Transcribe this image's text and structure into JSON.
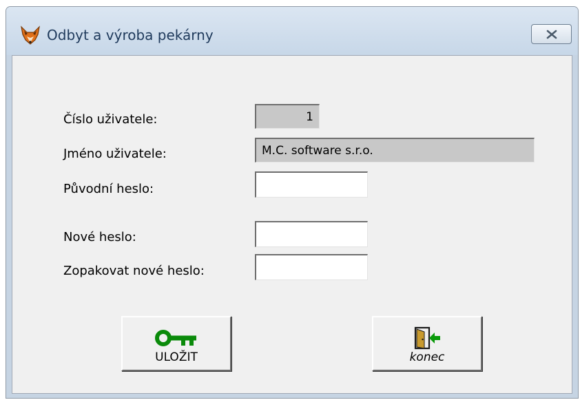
{
  "window": {
    "title": "Odbyt a výroba pekárny",
    "icon": "fox-icon",
    "close_icon": "close-icon"
  },
  "form": {
    "user_number_label": "Číslo uživatele:",
    "user_number_value": "1",
    "user_name_label": "Jméno uživatele:",
    "user_name_value": "M.C. software s.r.o.",
    "old_password_label": "Původní heslo:",
    "old_password_value": "",
    "new_password_label": "Nové heslo:",
    "new_password_value": "",
    "repeat_password_label": "Zopakovat nové heslo:",
    "repeat_password_value": ""
  },
  "buttons": {
    "save_label": "ULOŽIT",
    "save_icon": "key-icon",
    "end_label": "konec",
    "end_icon": "exit-door-icon"
  },
  "colors": {
    "key_green": "#0a8a0a",
    "readonly_field": "#c8c8c8",
    "dialog_face": "#f0f0f0"
  }
}
